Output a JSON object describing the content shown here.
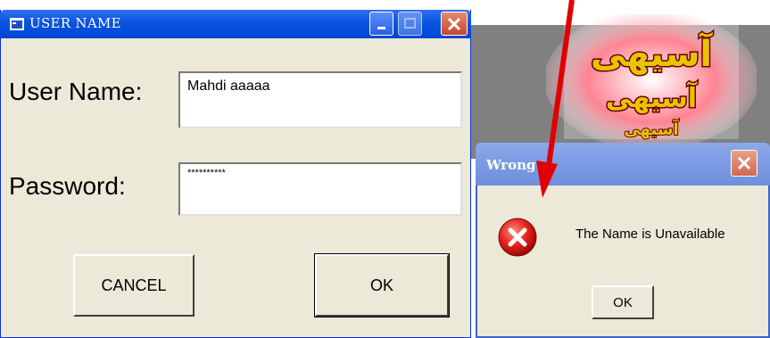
{
  "main_dialog": {
    "title": "USER NAME",
    "username_label": "User Name:",
    "username_value": "Mahdi aaaaa",
    "password_label": "Password:",
    "password_value": "**********",
    "cancel_label": "CANCEL",
    "ok_label": "OK"
  },
  "error_dialog": {
    "title": "Wrong",
    "message": "The Name is Unavailable",
    "ok_label": "OK"
  },
  "logo": {
    "lines": [
      "آسیهی",
      "آسیهی",
      "آسیهی"
    ]
  },
  "colors": {
    "title_bar": "#0a53e0",
    "inactive_title_bar": "#7b9ae3",
    "window_face": "#ece9d8",
    "arrow": "#e00000"
  }
}
